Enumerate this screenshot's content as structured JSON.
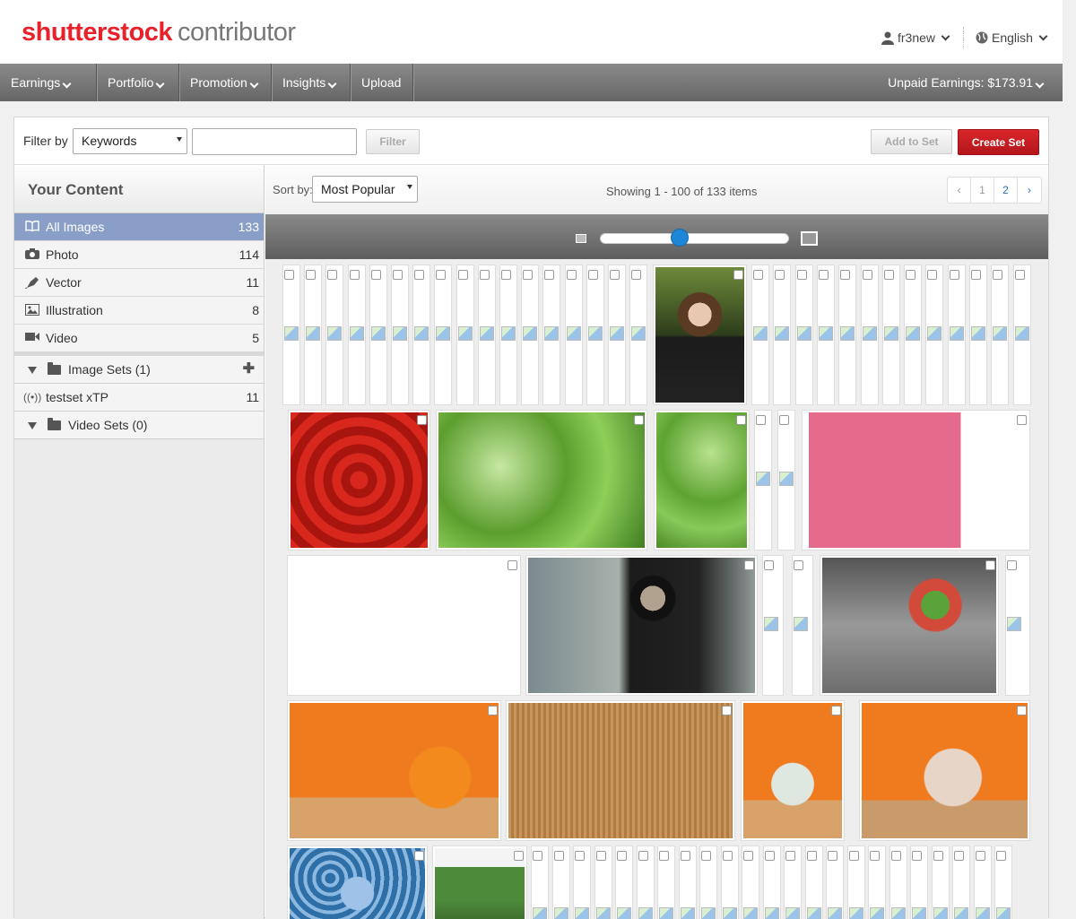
{
  "header": {
    "brand": "shutterstock",
    "brand_sub": "contributor",
    "user": "fr3new",
    "language": "English"
  },
  "nav": {
    "items": [
      "Earnings",
      "Portfolio",
      "Promotion",
      "Insights",
      "Upload"
    ],
    "unpaid": "Unpaid Earnings: $173.91"
  },
  "filter": {
    "label": "Filter by",
    "field": "Keywords",
    "input_value": "",
    "filter_button": "Filter",
    "add_to_set": "Add to Set",
    "create_set": "Create Set"
  },
  "sidebar": {
    "title": "Your Content",
    "items": [
      {
        "label": "All Images",
        "count": "133",
        "icon": "book-icon"
      },
      {
        "label": "Photo",
        "count": "114",
        "icon": "camera-icon"
      },
      {
        "label": "Vector",
        "count": "11",
        "icon": "pen-icon"
      },
      {
        "label": "Illustration",
        "count": "8",
        "icon": "picture-icon"
      },
      {
        "label": "Video",
        "count": "5",
        "icon": "video-icon"
      }
    ],
    "image_sets": "Image Sets (1)",
    "set_item": {
      "label": "testset xTP",
      "count": "11"
    },
    "video_sets": "Video Sets (0)"
  },
  "content": {
    "sort_label": "Sort by:",
    "sort_value": "Most Popular",
    "showing": "Showing 1 - 100 of 133 items",
    "pager": [
      "‹",
      "1",
      "2",
      "›"
    ],
    "zoom_level": 0.42
  },
  "colors": {
    "brand_red": "#e8212b",
    "nav_grey": "#777777",
    "active_row": "#8a9fc7",
    "create_set": "#c71e23",
    "slider_knob": "#1e86d6"
  }
}
